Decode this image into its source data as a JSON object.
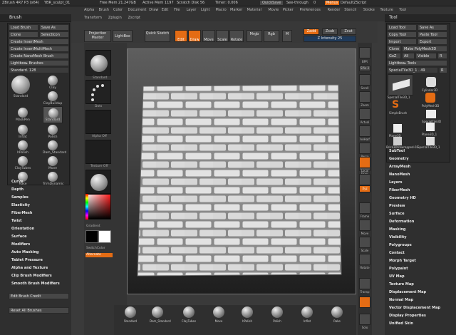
{
  "titlebar": {
    "app": "ZBrush 4R7 P3 (x64)",
    "file": "YBR_sculpt_01",
    "mem": "Free Mem 21.247GB",
    "active": "Active Mem 1197",
    "scratch": "Scratch Disk 56",
    "timer": "Timer: 0.006",
    "quicksave": "QuickSave",
    "seethrough": "See-through",
    "seethrough_val": "0",
    "menus_btn": "Menus",
    "script": "DefaultZScript"
  },
  "menus": [
    "Alpha",
    "Brush",
    "Color",
    "Document",
    "Draw",
    "Edit",
    "File",
    "Layer",
    "Light",
    "Macro",
    "Marker",
    "Material",
    "Movie",
    "Picker",
    "Preferences",
    "Render",
    "Stencil",
    "Stroke",
    "Texture",
    "Tool"
  ],
  "submenus": [
    "Transform",
    "Zplugin",
    "Zscript"
  ],
  "brush_panel": {
    "title": "Brush",
    "load": "Load Brush",
    "save": "Save As",
    "clone": "Clone",
    "select_icon": "SelectIcon",
    "create_insertmesh": "Create InsertMesh",
    "create_insertmultimesh": "Create InsertMultiMesh",
    "create_nanomesh": "Create NanoMesh Brush",
    "lightbox_brushes": "Lightbox▸ Brushes",
    "current": "Standard. 128",
    "brushes": [
      {
        "name": "Standard"
      },
      {
        "name": "Clay"
      },
      {
        "name": "ClayBuildup"
      },
      {
        "name": "MaskPen"
      },
      {
        "name": "Standard"
      },
      {
        "name": "Inflat"
      },
      {
        "name": "Polish"
      },
      {
        "name": "hPolish"
      },
      {
        "name": "Dam_Standard"
      },
      {
        "name": "ClayTubes"
      },
      {
        "name": "Move"
      },
      {
        "name": "Rake"
      },
      {
        "name": "TrimDynamic"
      }
    ],
    "menu_items": [
      "Curve",
      "Depth",
      "Samples",
      "Elasticity",
      "FiberMesh",
      "Twist",
      "Orientation",
      "Surface",
      "Modifiers",
      "Auto Masking",
      "Tablet Pressure",
      "Alpha and Texture",
      "Clip Brush Modifiers",
      "Smooth Brush Modifiers"
    ],
    "edit_credit": "Edit Brush Credit",
    "reset": "Reset All Brushes"
  },
  "shelf": {
    "standard": "Standard",
    "dots": "Dots",
    "alpha_off": "Alpha Off",
    "texture_off": "Texture Off",
    "matcap": "MatCap Gray",
    "gradient": "Gradient",
    "switch_color": "SwitchColor",
    "alternate": "Alternate"
  },
  "topbar": {
    "projection_master": "Projection Master",
    "lightbox": "LightBox",
    "quick_sketch": "Quick Sketch",
    "edit": "Edit",
    "draw": "Draw",
    "move": "Move",
    "scale": "Scale",
    "rotate": "Rotate",
    "mrgb": "Mrgb",
    "rgb": "Rgb",
    "m": "M",
    "zadd": "Zadd",
    "zsub": "Zsub",
    "zcut": "Zcut",
    "z_intensity": "Z Intensity 25"
  },
  "right_strip": [
    "BPR",
    "SPix 3",
    "Scroll",
    "Zoom",
    "Actual",
    "AAHalf",
    "Persp",
    "Floor",
    "Local",
    "Lsym",
    "Xyz",
    "Frame",
    "Move",
    "Scale",
    "Rotate",
    "Transp",
    "Solo"
  ],
  "tool_panel": {
    "title": "Tool",
    "load_tool": "Load Tool",
    "save_as": "Save As",
    "copy_tool": "Copy Tool",
    "paste_tool": "Paste Tool",
    "import": "Import",
    "export": "Export",
    "clone": "Clone",
    "make_polymesh": "Make PolyMesh3D",
    "goz": "GoZ",
    "all": "All",
    "visible": "Visible",
    "r": "R",
    "lightbox_tools": "Lightbox▸ Tools",
    "current": "SpecialTile3D_1 . 49",
    "tools": [
      "SpecialTile3D_1",
      "Cylinder3D",
      "PolyMesh3D",
      "SimpleBrush",
      "SpecialTile3D",
      "Plane3D",
      "Plane3D_1",
      "Brick3DUnwrapped-03",
      "SpecialTile3D_1"
    ],
    "menu_items": [
      "SubTool",
      "Geometry",
      "ArrayMesh",
      "NanoMesh",
      "Layers",
      "FiberMesh",
      "Geometry HD",
      "Preview",
      "Surface",
      "Deformation",
      "Masking",
      "Visibility",
      "Polygroups",
      "Contact",
      "Morph Target",
      "Polypaint",
      "UV Map",
      "Texture Map",
      "Displacement Map",
      "Normal Map",
      "Vector Displacement Map",
      "Display Properties",
      "Unified Skin"
    ]
  },
  "bottom_brushes": [
    "Standard",
    "Dam_Standard",
    "ClayTubes",
    "Move",
    "hPolish",
    "Polish",
    "Inflat",
    "Rake"
  ],
  "colors": {
    "accent": "#e46c14",
    "panel": "#2f2f2f",
    "button": "#474747"
  }
}
